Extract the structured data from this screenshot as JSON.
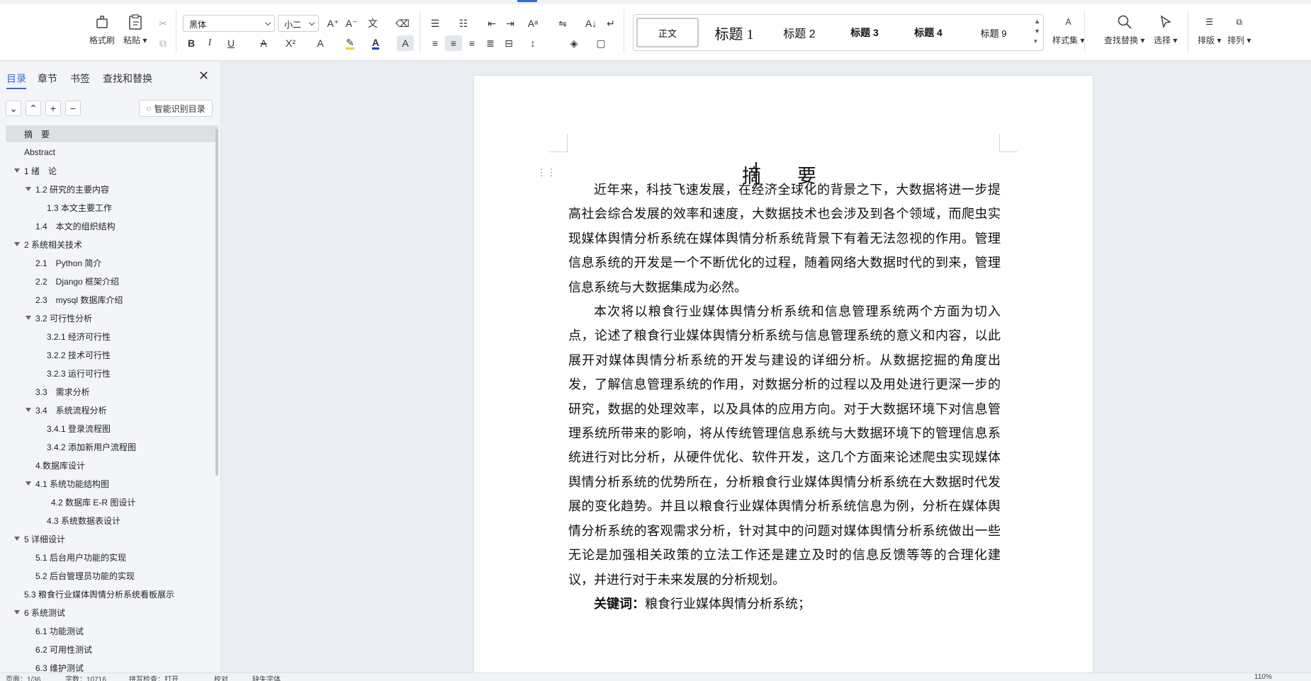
{
  "ribbon": {
    "format_painter": "格式刷",
    "paste": "粘贴",
    "font_name": "黑体",
    "font_size": "小二",
    "style_gallery": [
      "正文",
      "标题 1",
      "标题 2",
      "标题 3",
      "标题 4",
      "标题 9"
    ],
    "style_set": "样式集",
    "find_replace": "查找替换",
    "select": "选择",
    "layout": "排版",
    "arrange": "排列",
    "bold": "B",
    "italic": "I",
    "underline": "U",
    "accent_color": "#2a6fdb",
    "highlight_color": "#f5d000",
    "font_color": "#1d3bd6"
  },
  "nav": {
    "tabs": [
      "目录",
      "章节",
      "书签",
      "查找和替换"
    ],
    "smart_toc": "智能识别目录",
    "items": [
      {
        "label": "摘　要",
        "level": 0,
        "arrow": false,
        "current": true
      },
      {
        "label": "Abstract",
        "level": 0,
        "arrow": false
      },
      {
        "label": "1 绪　论",
        "level": 0,
        "arrow": true
      },
      {
        "label": "1.2  研究的主要内容",
        "level": 1,
        "arrow": true
      },
      {
        "label": "1.3  本文主要工作",
        "level": 2,
        "arrow": false
      },
      {
        "label": "1.4　本文的组织结构",
        "level": 1,
        "arrow": false
      },
      {
        "label": "2 系统相关技术",
        "level": 0,
        "arrow": true
      },
      {
        "label": "2.1　Python 简介",
        "level": 1,
        "arrow": false
      },
      {
        "label": "2.2　Django 框架介绍",
        "level": 1,
        "arrow": false
      },
      {
        "label": "2.3　mysql 数据库介绍",
        "level": 1,
        "arrow": false
      },
      {
        "label": "3.2  可行性分析",
        "level": 1,
        "arrow": true
      },
      {
        "label": "3.2.1  经济可行性",
        "level": 2,
        "arrow": false
      },
      {
        "label": "3.2.2  技术可行性",
        "level": 2,
        "arrow": false
      },
      {
        "label": "3.2.3  运行可行性",
        "level": 2,
        "arrow": false
      },
      {
        "label": "3.3　需求分析",
        "level": 1,
        "arrow": false
      },
      {
        "label": "3.4　系统流程分析",
        "level": 1,
        "arrow": true
      },
      {
        "label": "3.4.1  登录流程图",
        "level": 2,
        "arrow": false
      },
      {
        "label": "3.4.2  添加新用户流程图",
        "level": 2,
        "arrow": false
      },
      {
        "label": "4.数据库设计",
        "level": 1,
        "arrow": false
      },
      {
        "label": "4.1 系统功能结构图",
        "level": 1,
        "arrow": true
      },
      {
        "label": "4.2  数据库 E-R 图设计",
        "level": 3,
        "arrow": false
      },
      {
        "label": "4.3 系统数据表设计",
        "level": 2,
        "arrow": false
      },
      {
        "label": "5 详细设计",
        "level": 0,
        "arrow": true
      },
      {
        "label": "5.1  后台用户功能的实现",
        "level": 1,
        "arrow": false
      },
      {
        "label": "5.2  后台管理员功能的实现",
        "level": 1,
        "arrow": false
      },
      {
        "label": "5.3 粮食行业媒体舆情分析系统看板展示",
        "level": 0,
        "arrow": false
      },
      {
        "label": "6 系统测试",
        "level": 0,
        "arrow": true
      },
      {
        "label": "6.1  功能测试",
        "level": 1,
        "arrow": false
      },
      {
        "label": "6.2  可用性测试",
        "level": 1,
        "arrow": false
      },
      {
        "label": "6.3  维护测试",
        "level": 1,
        "arrow": false
      }
    ]
  },
  "document": {
    "title": "摘　要",
    "paragraphs": [
      "近年来，科技飞速发展，在经济全球化的背景之下，大数据将进一步提高社会综合发展的效率和速度，大数据技术也会涉及到各个领域，而爬虫实现媒体舆情分析系统在媒体舆情分析系统背景下有着无法忽视的作用。管理信息系统的开发是一个不断优化的过程，随着网络大数据时代的到来，管理信息系统与大数据集成为必然。",
      "本次将以粮食行业媒体舆情分析系统和信息管理系统两个方面为切入点，论述了粮食行业媒体舆情分析系统与信息管理系统的意义和内容，以此展开对媒体舆情分析系统的开发与建设的详细分析。从数据挖掘的角度出发，了解信息管理系统的作用，对数据分析的过程以及用处进行更深一步的研究，数据的处理效率，以及具体的应用方向。对于大数据环境下对信息管理系统所带来的影响，将从传统管理信息系统与大数据环境下的管理信息系统进行对比分析，从硬件优化、软件开发，这几个方面来论述爬虫实现媒体舆情分析系统的优势所在，分析粮食行业媒体舆情分析系统在大数据时代发展的变化趋势。并且以粮食行业媒体舆情分析系统信息为例，分析在媒体舆情分析系统的客观需求分析，针对其中的问题对媒体舆情分析系统做出一些无论是加强相关政策的立法工作还是建立及时的信息反馈等等的合理化建议，并进行对于未来发展的分析规划。"
    ],
    "keywords_label": "关键词：",
    "keywords": "粮食行业媒体舆情分析系统；"
  },
  "status": {
    "page": "页面：1/36",
    "words": "字数：10716",
    "spell": "拼写检查：打开",
    "proof": "校对",
    "font_missing": "缺失字体",
    "zoom": "110%"
  }
}
